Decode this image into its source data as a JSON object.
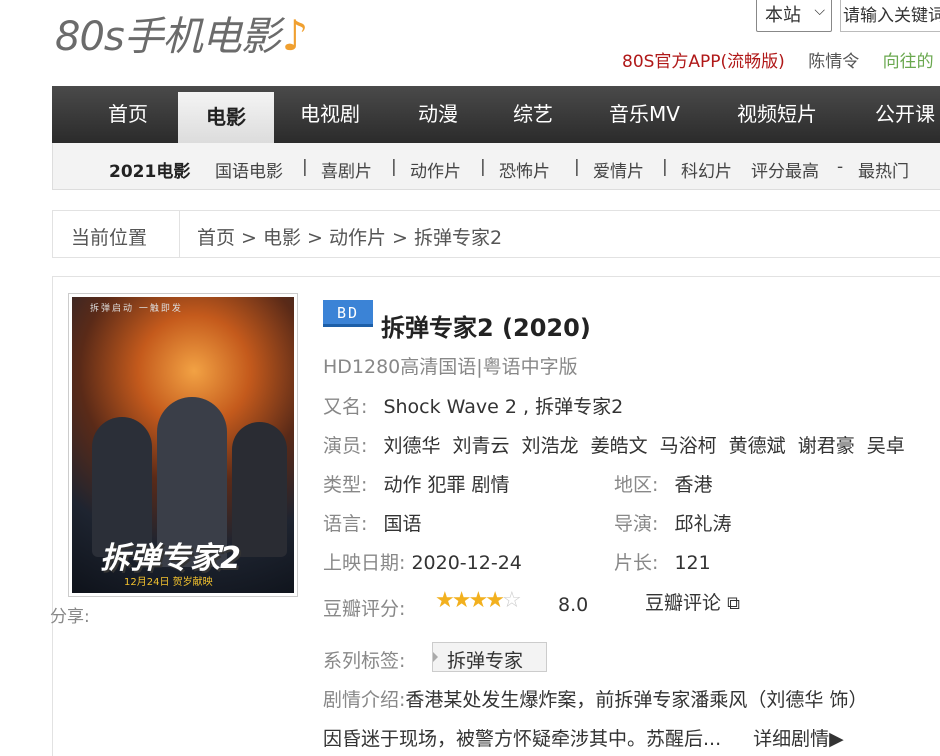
{
  "header": {
    "logo_text": "80s手机电影",
    "logo_note": "♪",
    "site_select": "本站",
    "search_placeholder": "请输入关键词",
    "app_link": "80S官方APP(流畅版)",
    "link1": "陈情令",
    "link2": "向往的"
  },
  "nav": {
    "items": [
      "首页",
      "电影",
      "电视剧",
      "动漫",
      "综艺",
      "音乐MV",
      "视频短片",
      "公开课"
    ],
    "active_index": 1
  },
  "subnav": {
    "year": "2021电影",
    "items": [
      "国语电影",
      "|",
      "喜剧片",
      "|",
      "动作片",
      "|",
      "恐怖片",
      "|",
      "爱情片",
      "|",
      "科幻片",
      "评分最高",
      "-",
      "最热门"
    ]
  },
  "breadcrumb": {
    "label": "当前位置",
    "path": "首页 > 电影 > 动作片 > 拆弹专家2"
  },
  "poster": {
    "tagline": "拆弹启动 一触即发",
    "title": "拆弹专家2",
    "date": "12月24日 贺岁献映"
  },
  "share_label": "分享:",
  "movie": {
    "badge": "BD",
    "title": "拆弹专家2 (2020)",
    "subtitle": "HD1280高清国语|粤语中字版",
    "aka_label": "又名:",
    "aka": "Shock Wave 2 , 拆弹专家2",
    "cast_label": "演员:",
    "cast": "刘德华  刘青云  刘浩龙  姜皓文  马浴柯  黄德斌  谢君豪  吴卓",
    "genre_label": "类型:",
    "genre": "动作 犯罪 剧情",
    "region_label": "地区:",
    "region": "香港",
    "language_label": "语言:",
    "language": "国语",
    "director_label": "导演:",
    "director": "邱礼涛",
    "release_label": "上映日期:",
    "release": "2020-12-24",
    "runtime_label": "片长:",
    "runtime": "121",
    "douban_label": "豆瓣评分:",
    "douban_score": "8.0",
    "douban_stars": 4,
    "douban_review": "豆瓣评论",
    "series_label": "系列标签:",
    "series_tag": "拆弹专家",
    "plot_label": "剧情介绍:",
    "plot_line1": "香港某处发生爆炸案，前拆弹专家潘乘风（刘德华 饰）",
    "plot_line2": "因昏迷于现场，被警方怀疑牵涉其中。苏醒后...",
    "more_link": "详细剧情▶"
  }
}
